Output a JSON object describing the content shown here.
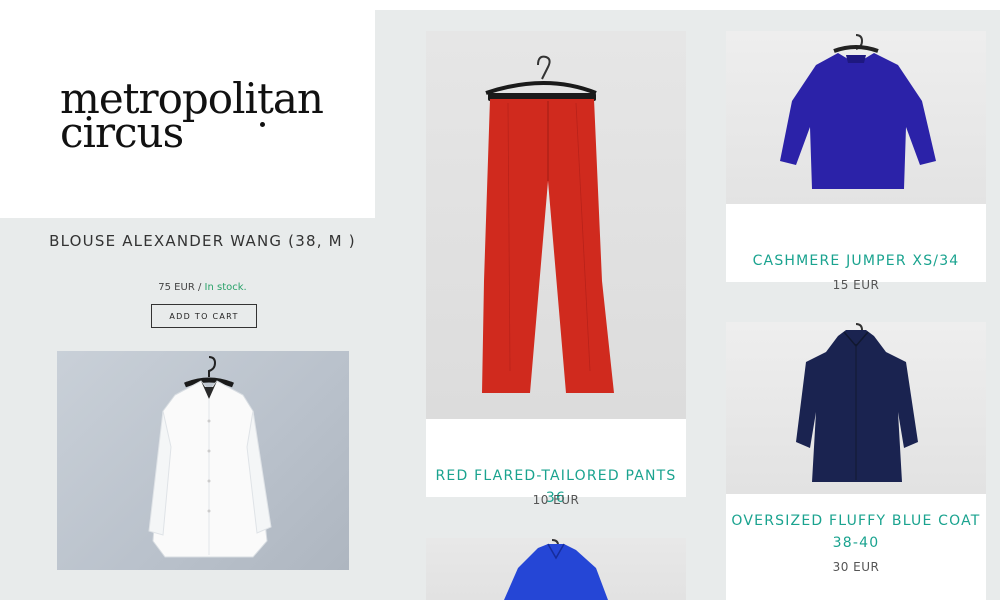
{
  "brand": {
    "line1": "metropolitan",
    "line2": "circus"
  },
  "featured": {
    "title": "BLOUSE ALEXANDER WANG (38, M )",
    "price": "75 EUR",
    "separator": " / ",
    "stock": "In stock.",
    "add_to_cart": "ADD TO CART",
    "image_icon": "white-blouse-on-hanger"
  },
  "products": [
    {
      "name": "RED FLARED-TAILORED PANTS 36",
      "price": "10 EUR",
      "image_icon": "red-pants-on-hanger",
      "color": "#d02a1e"
    },
    {
      "name": "CASHMERE JUMPER XS/34",
      "price": "15 EUR",
      "image_icon": "blue-jumper-on-hanger",
      "color": "#2b22a8"
    },
    {
      "name": "OVERSIZED FLUFFY BLUE COAT 38-40",
      "price": "30 EUR",
      "image_icon": "navy-coat-on-hanger",
      "color": "#1a2350"
    },
    {
      "name": "",
      "price": "",
      "image_icon": "blue-jacket-on-hanger",
      "color": "#2546d6"
    }
  ],
  "colors": {
    "accent": "#1aa38f",
    "in_stock": "#2aa26a",
    "background": "#e8ebeb"
  }
}
